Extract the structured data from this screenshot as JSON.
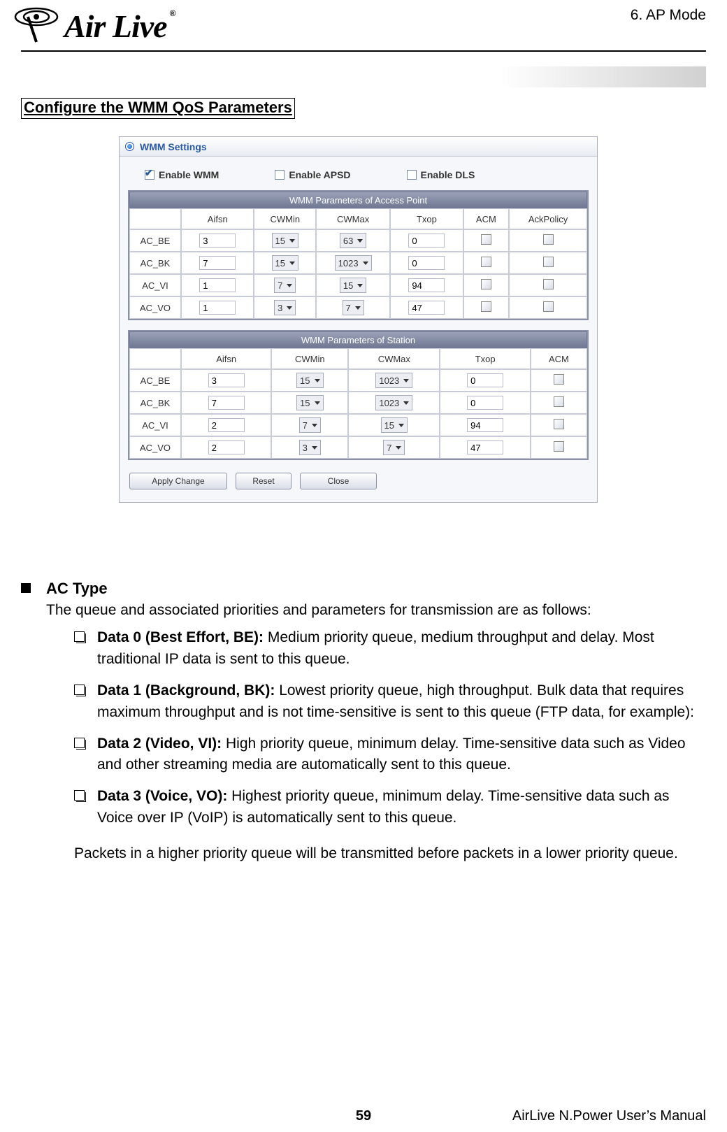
{
  "header": {
    "logo": "Air Live",
    "trademark": "®",
    "chapter": "6. AP Mode"
  },
  "section_title": "Configure the WMM QoS Parameters",
  "panel": {
    "title": "WMM Settings",
    "enable": {
      "wmm": {
        "label": "Enable WMM",
        "checked": true
      },
      "apsd": {
        "label": "Enable APSD",
        "checked": false
      },
      "dls": {
        "label": "Enable DLS",
        "checked": false
      }
    },
    "ap": {
      "caption": "WMM Parameters of Access Point",
      "headers": [
        "",
        "Aifsn",
        "CWMin",
        "CWMax",
        "Txop",
        "ACM",
        "AckPolicy"
      ],
      "rows": [
        {
          "name": "AC_BE",
          "aifsn": "3",
          "cwmin": "15",
          "cwmax": "63",
          "txop": "0",
          "acm": false,
          "ack": false
        },
        {
          "name": "AC_BK",
          "aifsn": "7",
          "cwmin": "15",
          "cwmax": "1023",
          "txop": "0",
          "acm": false,
          "ack": false
        },
        {
          "name": "AC_VI",
          "aifsn": "1",
          "cwmin": "7",
          "cwmax": "15",
          "txop": "94",
          "acm": false,
          "ack": false
        },
        {
          "name": "AC_VO",
          "aifsn": "1",
          "cwmin": "3",
          "cwmax": "7",
          "txop": "47",
          "acm": false,
          "ack": false
        }
      ]
    },
    "sta": {
      "caption": "WMM Parameters of Station",
      "headers": [
        "",
        "Aifsn",
        "CWMin",
        "CWMax",
        "Txop",
        "ACM"
      ],
      "rows": [
        {
          "name": "AC_BE",
          "aifsn": "3",
          "cwmin": "15",
          "cwmax": "1023",
          "txop": "0",
          "acm": false
        },
        {
          "name": "AC_BK",
          "aifsn": "7",
          "cwmin": "15",
          "cwmax": "1023",
          "txop": "0",
          "acm": false
        },
        {
          "name": "AC_VI",
          "aifsn": "2",
          "cwmin": "7",
          "cwmax": "15",
          "txop": "94",
          "acm": false
        },
        {
          "name": "AC_VO",
          "aifsn": "2",
          "cwmin": "3",
          "cwmax": "7",
          "txop": "47",
          "acm": false
        }
      ]
    },
    "buttons": {
      "apply": "Apply Change",
      "reset": "Reset",
      "close": "Close"
    }
  },
  "body": {
    "ac_type_heading": "AC Type",
    "ac_type_intro": "The queue and associated priorities and parameters for transmission are as follows:",
    "items": [
      {
        "bold": "Data 0 (Best Effort, BE):",
        "text": " Medium priority queue, medium throughput and delay. Most traditional IP data is sent to this queue."
      },
      {
        "bold": "Data 1 (Background, BK):",
        "text": " Lowest priority queue, high throughput. Bulk data that requires maximum throughput and is not time-sensitive is sent to this queue (FTP data, for example):"
      },
      {
        "bold": "Data 2 (Video, VI):",
        "text": " High priority queue, minimum delay. Time-sensitive data such as Video and other streaming media are automatically sent to this queue."
      },
      {
        "bold": "Data 3 (Voice, VO):",
        "text": " Highest priority queue, minimum delay. Time-sensitive data such as Voice over IP (VoIP) is automatically sent to this queue."
      }
    ],
    "closing": "Packets in a higher priority queue will be transmitted before packets in a lower priority queue."
  },
  "footer": {
    "page": "59",
    "manual": "AirLive N.Power User’s Manual"
  }
}
